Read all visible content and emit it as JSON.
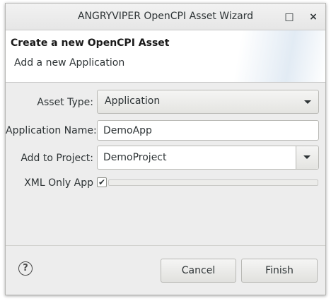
{
  "window": {
    "title": "ANGRYVIPER OpenCPI Asset Wizard",
    "maximize_glyph": "□",
    "close_glyph": "×"
  },
  "banner": {
    "title": "Create a new OpenCPI Asset",
    "subtitle": "Add a new Application"
  },
  "form": {
    "asset_type": {
      "label": "Asset Type:",
      "value": "Application"
    },
    "application_name": {
      "label": "Application Name:",
      "value": "DemoApp"
    },
    "project": {
      "label": "Add to Project:",
      "value": "DemoProject"
    },
    "xml_only": {
      "label": "XML Only App",
      "checked": true,
      "check_glyph": "✔"
    }
  },
  "footer": {
    "help_glyph": "?",
    "cancel_label": "Cancel",
    "finish_label": "Finish"
  },
  "colors": {
    "window_bg": "#ededed",
    "banner_accent": "#e2ebf4"
  }
}
